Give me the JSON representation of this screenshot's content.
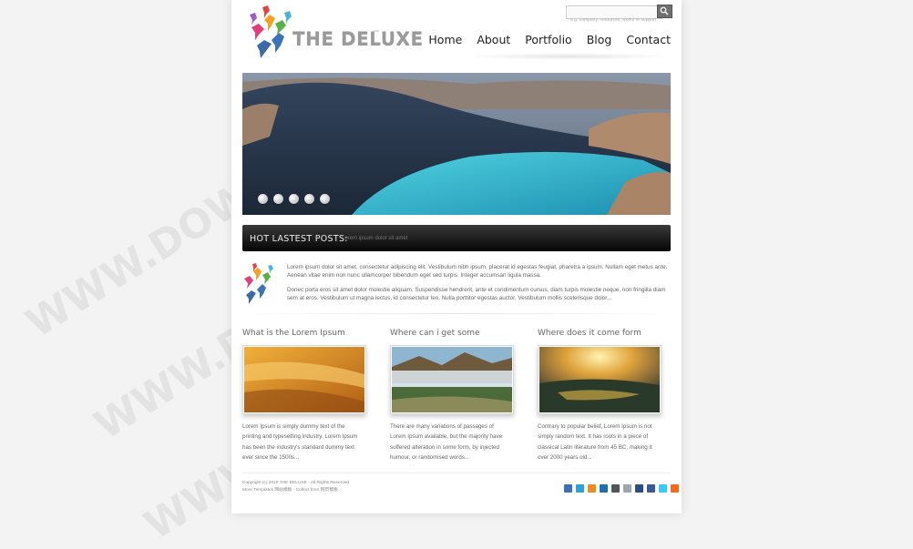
{
  "brand": {
    "name": "THE DELUXE",
    "tm": "™"
  },
  "search": {
    "placeholder": "",
    "hint": "e.g. company, resources, works or support"
  },
  "nav": [
    {
      "label": "Home"
    },
    {
      "label": "About"
    },
    {
      "label": "Portfolio"
    },
    {
      "label": "Blog"
    },
    {
      "label": "Contact"
    }
  ],
  "slider": {
    "dots": 5,
    "active": 0
  },
  "hot_posts": {
    "title": "HOT LASTEST POSTS:",
    "text": "Lorem ipsum dolor sit amet"
  },
  "intro": {
    "p1": "Lorem ipsum dolor sit amet, consectetur adipiscing elit. Vestibulum nibh ipsum, placerat id egestas feugiat, pharetra a ipsum. Nullam eget metus ante. Aenean vitae enim non nunc ullamcorper bibendum eget sed turpis. Integer accumsan ligula massa.",
    "p2": "Donec porta eros sit amet dolor molestie aliquam. Suspendisse hendrerit, ante et condimentum cursus, diam turpis molestie neque, non fringilla diam sem at eros. Vestibulum ut magna lectus, id consectetur leo. Nulla porttitor egestas auctor. Vestibulum mollis scelerisque dolor..."
  },
  "columns": [
    {
      "title": "What is the Lorem Ipsum",
      "text": "Lorem Ipsum is simply dummy text of the printing and typesetting industry. Lorem Ipsum has been the industry's standard dummy text ever since the 1500s..."
    },
    {
      "title": "Where can i get some",
      "text": "There are many variations of passages of Lorem Ipsum available, but the majority have suffered alteration in some form, by injected humour, or randomised words..."
    },
    {
      "title": "Where does it come form",
      "text": "Contrary to popular belief, Lorem Ipsum is not simply random text. It has roots in a piece of classical Latin literature from 45 BC, making it over 2000 years old..."
    }
  ],
  "footer": {
    "copyright": "Copyright (c) 2010 THE DELUXE - All Rights Reserved",
    "credit": "More Templates 网站模板 - Collect from 网页模板"
  },
  "watermark": "WWW.DOWNDEMO.COM",
  "colors": {
    "accent": "#3fb9c9",
    "bar": "#111111",
    "page": "#ffffff"
  },
  "social_icons": [
    "flickr-icon",
    "skype-icon",
    "rss-icon",
    "linkedin-icon",
    "delicious-icon",
    "reddit-icon",
    "digg-icon",
    "facebook-icon",
    "twitter-icon",
    "rss-feed-icon"
  ]
}
